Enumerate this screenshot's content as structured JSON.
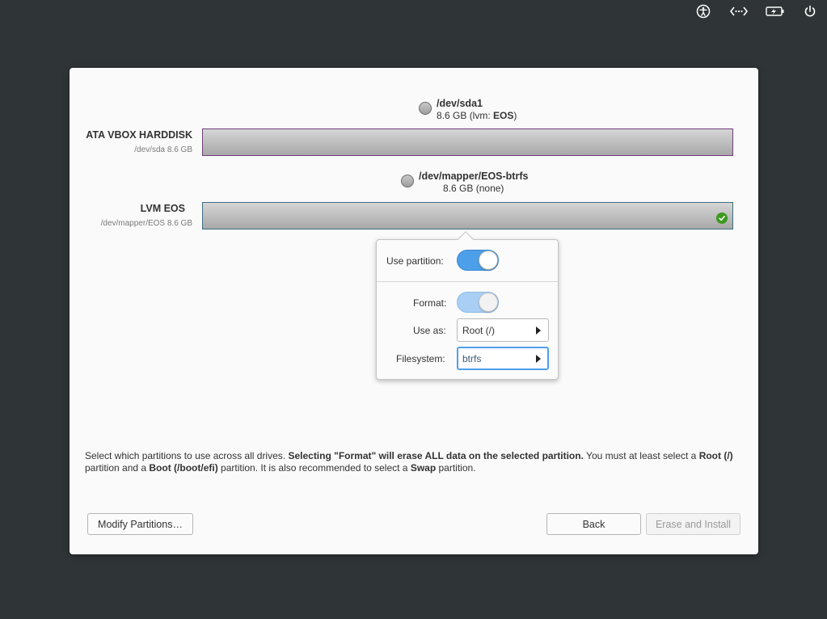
{
  "topbar": {
    "icons": [
      "accessibility-icon",
      "network-icon",
      "battery-charging-icon",
      "power-icon"
    ]
  },
  "drives": [
    {
      "name": "ATA VBOX HARDDISK",
      "sub": "/dev/sda 8.6 GB",
      "partition": {
        "path": "/dev/sda1",
        "size_prefix": "8.6 GB (lvm: ",
        "size_bold": "EOS",
        "size_suffix": ")"
      },
      "border_color": "#6f3f7a"
    },
    {
      "name": "LVM EOS",
      "sub": "/dev/mapper/EOS 8.6 GB",
      "partition": {
        "path": "/dev/mapper/EOS-btrfs",
        "size": "8.6 GB (none)"
      },
      "border_color": "#3e6f86"
    }
  ],
  "popover": {
    "use_partition_label": "Use partition:",
    "use_partition_on": true,
    "format_label": "Format:",
    "format_on": true,
    "use_as_label": "Use as:",
    "use_as_value": "Root (/)",
    "filesystem_label": "Filesystem:",
    "filesystem_value": "btrfs"
  },
  "info": {
    "t1": "Select which partitions to use across all drives. ",
    "b1": "Selecting \"Format\" will erase ALL data on the selected partition.",
    "t2": " You must at least select a ",
    "b2": "Root (/)",
    "t3": " partition and a ",
    "b3": "Boot (/boot/efi)",
    "t4": " partition. It is also recommended to select a ",
    "b4": "Swap",
    "t5": " partition."
  },
  "buttons": {
    "modify": "Modify Partitions…",
    "back": "Back",
    "erase": "Erase and Install"
  },
  "colors": {
    "accent": "#4d9fea",
    "success": "#3a9a1e",
    "background": "#2f3537"
  }
}
